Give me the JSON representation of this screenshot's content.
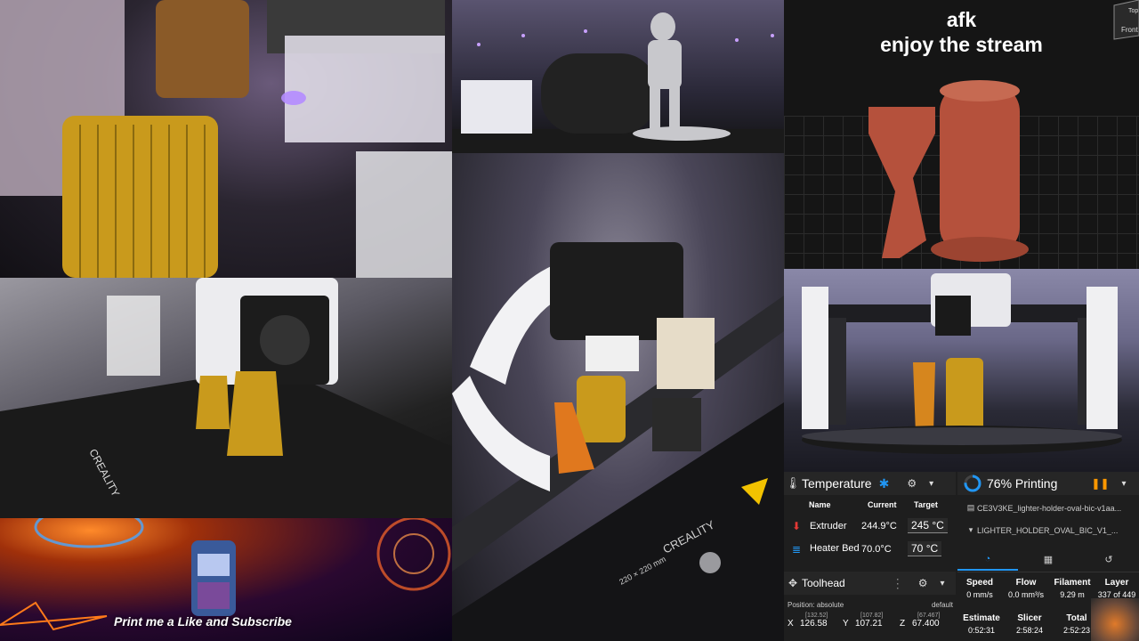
{
  "overlay": {
    "line1": "afk",
    "line2": "enjoy the stream"
  },
  "corner_nav": {
    "top": "Top",
    "front": "Front"
  },
  "banner": {
    "text": "Print me a Like and Subscribe"
  },
  "bed_labels": {
    "brand": "CREALITY",
    "size": "220 × 220 mm"
  },
  "temperature": {
    "title": "Temperature",
    "columns": [
      "Name",
      "Current",
      "Target"
    ],
    "rows": [
      {
        "name": "Extruder",
        "current": "244.9°C",
        "target": "245",
        "unit": "°C"
      },
      {
        "name": "Heater Bed",
        "current": "70.0°C",
        "target": "70",
        "unit": "°C"
      }
    ]
  },
  "toolhead": {
    "title": "Toolhead",
    "position_label": "Position: absolute",
    "mode": "default",
    "axes": [
      {
        "axis": "X",
        "requested": "[132.52]",
        "value": "126.58"
      },
      {
        "axis": "Y",
        "requested": "[107.82]",
        "value": "107.21"
      },
      {
        "axis": "Z",
        "requested": "[67.467]",
        "value": "67.400"
      }
    ]
  },
  "status": {
    "progress_percent": 76,
    "title": "76% Printing",
    "file1": "CE3V3KE_lighter-holder-oval-bic-v1aa...",
    "file2": "LIGHTER_HOLDER_OVAL_BIC_V1_...",
    "stats": [
      {
        "label": "Speed",
        "value": "0 mm/s"
      },
      {
        "label": "Flow",
        "value": "0.0 mm³/s"
      },
      {
        "label": "Filament",
        "value": "9.29 m"
      },
      {
        "label": "Layer",
        "value": "337 of 449"
      }
    ],
    "times": [
      {
        "label": "Estimate",
        "value": "0:52:31"
      },
      {
        "label": "Slicer",
        "value": "2:58:24"
      },
      {
        "label": "Total",
        "value": "2:52:23"
      }
    ]
  },
  "colors": {
    "accent": "#2196f3",
    "pause": "#ff9800",
    "heater": "#e53935",
    "filament": "#d9a521"
  },
  "icons": [
    "thermometer-icon",
    "snowflake-icon",
    "gear-icon",
    "chevron-down-icon",
    "move-icon",
    "pause-icon",
    "file-icon",
    "nozzle-icon",
    "speedometer-icon",
    "document-icon",
    "history-icon"
  ]
}
